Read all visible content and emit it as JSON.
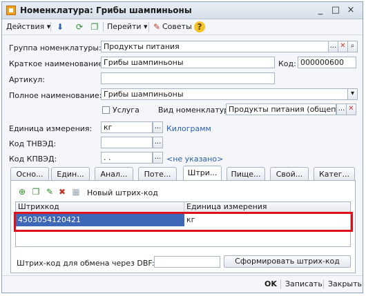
{
  "window": {
    "title": "Номенклатура: Грибы шампиньоны",
    "controls": [
      "_",
      "□",
      "×"
    ]
  },
  "toolbar": {
    "actions": "Действия",
    "goto": "Перейти",
    "tips": "Советы",
    "help": "?"
  },
  "form": {
    "group_label": "Группа номенклатуры:",
    "group_value": "Продукты питания",
    "short_label": "Краткое наименование:",
    "short_value": "Грибы шампиньоны",
    "code_label": "Код:",
    "code_value": "000000600",
    "article_label": "Артикул:",
    "article_value": "",
    "full_label": "Полное наименование:",
    "full_value": "Грибы шампиньоны",
    "service_label": "Услуга",
    "kind_label": "Вид номенклатуры:",
    "kind_value": "Продукты питания (общепит)",
    "unit_label": "Единица измерения:",
    "unit_value": "кг",
    "unit_link": "Килограмм",
    "tnved_label": "Код ТНВЭД:",
    "tnved_value": "",
    "kpved_label": "Код КПВЭД:",
    "kpved_value": ". .",
    "kpved_link": "<не указано>"
  },
  "tabs": [
    "Осно...",
    "Един...",
    "Анал...",
    "Поте...",
    "Штри...",
    "Пище...",
    "Свой...",
    "Катег..."
  ],
  "barcodes": {
    "new_label": "Новый штрих-код",
    "columns": [
      "Штрихкод",
      "Единица измерения"
    ],
    "rows": [
      {
        "code": "4503054120421",
        "unit": "кг"
      }
    ],
    "dbf_label": "Штрих-код для обмена через DBF:",
    "dbf_value": "",
    "generate": "Сформировать штрих-код"
  },
  "footer": {
    "ok": "OK",
    "save": "Записать",
    "close": "Закрыть"
  },
  "colors": {
    "highlight": "#e0101a",
    "selection": "#3f67b7",
    "link": "#2a5db0"
  }
}
